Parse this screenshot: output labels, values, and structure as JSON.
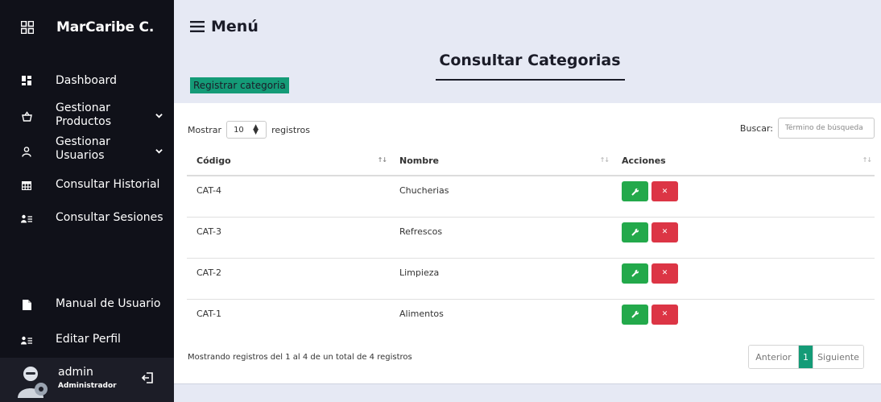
{
  "brand": {
    "title": "MarCaribe C."
  },
  "sidebar": {
    "items": [
      {
        "label": "Dashboard",
        "icon": "dashboard-icon"
      },
      {
        "label": "Gestionar Productos",
        "icon": "basket-icon"
      },
      {
        "label": "Gestionar Usuarios",
        "icon": "user-icon"
      },
      {
        "label": "Consultar Historial",
        "icon": "table-icon"
      },
      {
        "label": "Consultar Sesiones",
        "icon": "user-list-icon"
      },
      {
        "label": "Manual de Usuario",
        "icon": "document-icon"
      },
      {
        "label": "Editar Perfil",
        "icon": "user-list-icon"
      }
    ],
    "user": {
      "name": "admin",
      "role": "Administrador"
    }
  },
  "header": {
    "menu_label": "Menú"
  },
  "page": {
    "title": "Consultar Categorias",
    "register_label": "Registrar categoria"
  },
  "table_controls": {
    "show_label": "Mostrar",
    "length_value": "10",
    "records_label": "registros",
    "search_label": "Buscar:",
    "search_placeholder": "Término de búsqueda"
  },
  "table": {
    "columns": [
      "Código",
      "Nombre",
      "Acciones"
    ],
    "rows": [
      {
        "code": "CAT-4",
        "name": "Chucherias"
      },
      {
        "code": "CAT-3",
        "name": "Refrescos"
      },
      {
        "code": "CAT-2",
        "name": "Limpieza"
      },
      {
        "code": "CAT-1",
        "name": "Alimentos"
      }
    ]
  },
  "footer": {
    "info": "Mostrando registros del 1 al 4 de un total de 4 registros",
    "prev_label": "Anterior",
    "current_page": "1",
    "next_label": "Siguiente"
  },
  "colors": {
    "sidebar_bg": "#101119",
    "accent": "#149b77",
    "edit_btn": "#23a94b",
    "delete_btn": "#dc3545",
    "page_bg": "#e6e9f4"
  }
}
